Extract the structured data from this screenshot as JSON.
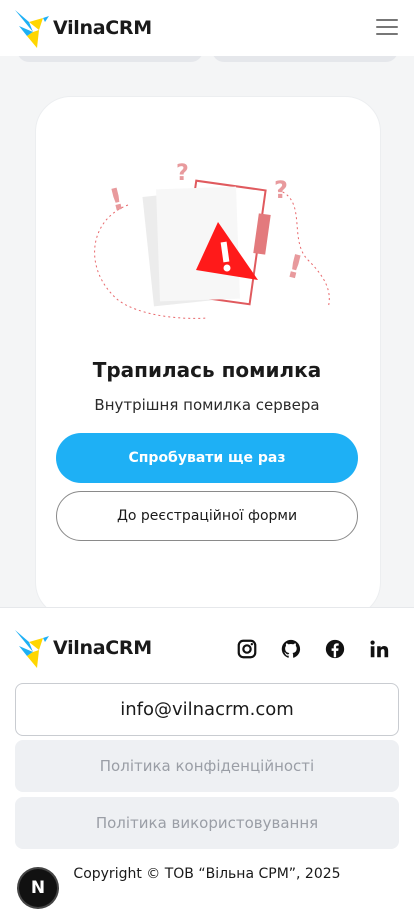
{
  "header": {
    "logo_text": "VilnaCRM",
    "menu_icon": "hamburger-menu-icon"
  },
  "error": {
    "title": "Трапилась помилка",
    "message": "Внутрішня помилка сервера",
    "retry_label": "Спробувати ще раз",
    "back_label": "До реєстраційної форми"
  },
  "footer": {
    "logo_text": "VilnaCRM",
    "social_icons": [
      "instagram-icon",
      "github-icon",
      "facebook-icon",
      "linkedin-icon"
    ],
    "email": "info@vilnacrm.com",
    "privacy_label": "Політика конфіденційності",
    "terms_label": "Політика використовування",
    "copyright": "Copyright © ТОВ “Вільна СРМ”, 2025"
  },
  "dev_badge": "N",
  "colors": {
    "accent": "#1eb0f5",
    "warning": "#ff1a1a",
    "logo_yellow": "#ffd600",
    "logo_blue": "#1eb0f5"
  }
}
